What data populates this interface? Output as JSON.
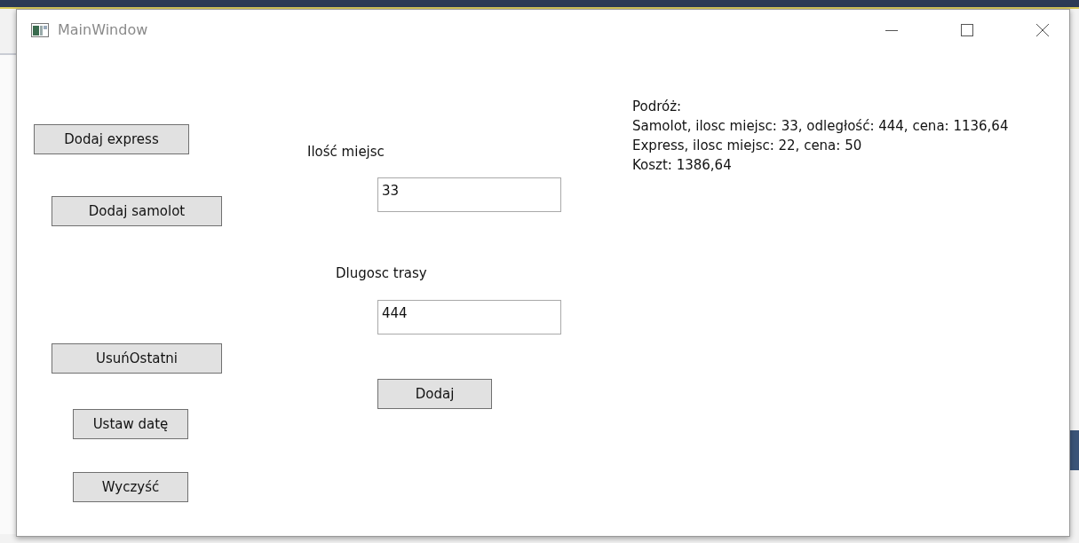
{
  "window": {
    "title": "MainWindow"
  },
  "left_buttons": [
    {
      "label": "Dodaj express"
    },
    {
      "label": "Dodaj samolot"
    },
    {
      "label": "UsuńOstatni"
    },
    {
      "label": "Ustaw datę"
    },
    {
      "label": "Wyczyść"
    }
  ],
  "fields": [
    {
      "label": "Ilość miejsc",
      "value": "33"
    },
    {
      "label": "Dlugosc trasy",
      "value": "444"
    }
  ],
  "add_button": {
    "label": "Dodaj"
  },
  "summary_lines": [
    "Podróż:",
    "Samolot, ilosc miejsc: 33, odległość: 444, cena: 1136,64",
    "Express, ilosc miejsc: 22, cena: 50",
    "Koszt: 1386,64"
  ]
}
